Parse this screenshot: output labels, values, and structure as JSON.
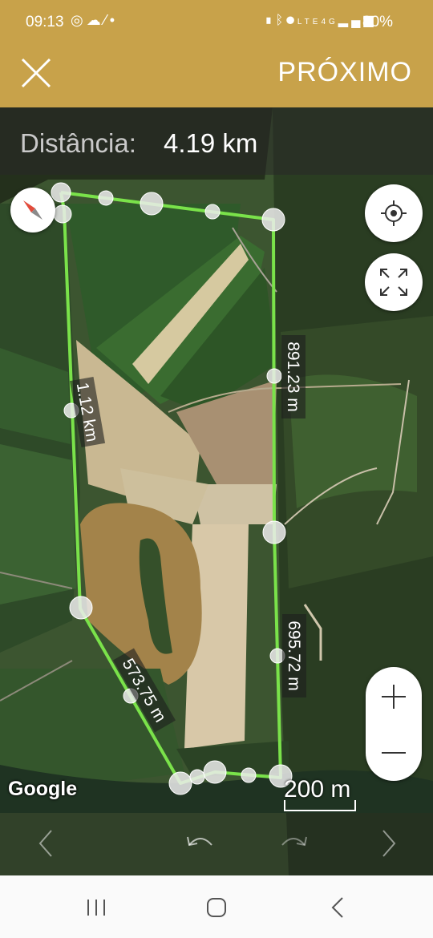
{
  "status_bar": {
    "time": "09:13",
    "left_icons": [
      "whatsapp-icon",
      "cloud-icon",
      "app-icon",
      "dot-icon"
    ],
    "right_icons": [
      "battery-saver-icon",
      "bluetooth-icon",
      "location-icon",
      "volte-icon",
      "4g-icon",
      "signal-icon"
    ],
    "battery": "80%"
  },
  "top_bar": {
    "close_icon": "close-icon",
    "next_label": "PRÓXIMO",
    "background_color": "#c8a24a"
  },
  "distance": {
    "label": "Distância:",
    "value": "4.19 km"
  },
  "map": {
    "route_color": "#7ae24a",
    "segment_labels": [
      "891.23 m",
      "1.12 km",
      "695.72 m",
      "573.75 m"
    ],
    "google_logo": "Google",
    "scale_label": "200 m"
  },
  "controls": {
    "compass_icon": "compass-icon",
    "locate_icon": "crosshair-icon",
    "fullscreen_icon": "expand-icon",
    "zoom_in_icon": "plus-icon",
    "zoom_out_icon": "minus-icon",
    "prev_icon": "chevron-left-icon",
    "undo_icon": "undo-icon",
    "redo_icon": "redo-icon",
    "next_icon": "chevron-right-icon"
  },
  "nav_bar": {
    "recent_icon": "recent-apps-icon",
    "home_icon": "home-icon",
    "back_icon": "back-icon"
  }
}
